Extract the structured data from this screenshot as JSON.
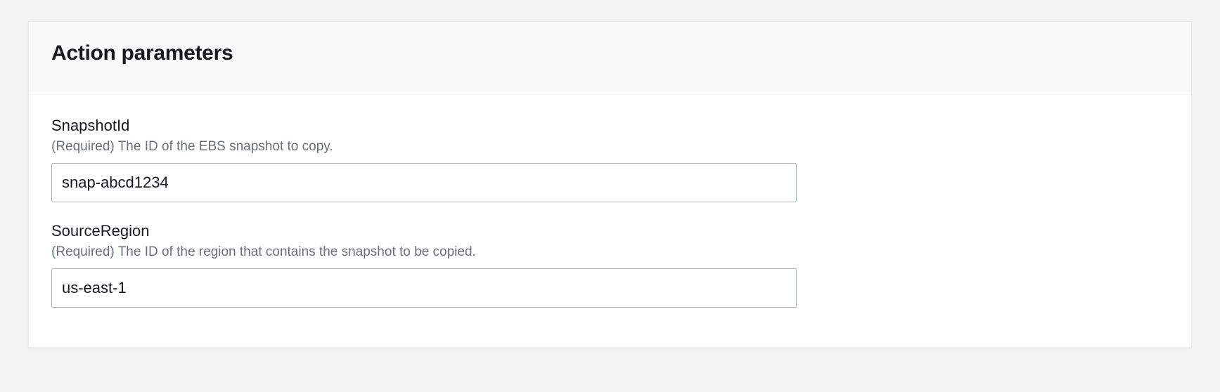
{
  "panel": {
    "title": "Action parameters"
  },
  "fields": {
    "snapshotId": {
      "label": "SnapshotId",
      "description": "(Required) The ID of the EBS snapshot to copy.",
      "value": "snap-abcd1234"
    },
    "sourceRegion": {
      "label": "SourceRegion",
      "description": "(Required) The ID of the region that contains the snapshot to be copied.",
      "value": "us-east-1"
    }
  }
}
